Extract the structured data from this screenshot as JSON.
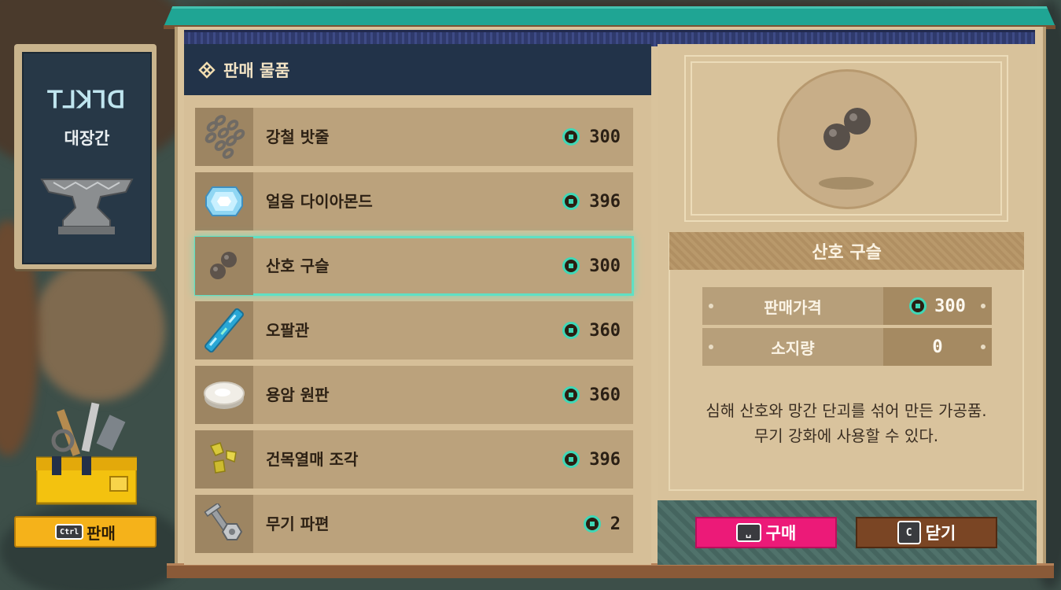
{
  "shop": {
    "sign_glyph": "ꓔ⅃ꓘꓶꓷ",
    "sign_label": "대장간",
    "sell_key": "Ctrl",
    "sell_label": "판매"
  },
  "list": {
    "header_title": "판매 물품",
    "items": [
      {
        "name": "강철 밧줄",
        "price": "300",
        "icon": "chain-icon"
      },
      {
        "name": "얼음 다이아몬드",
        "price": "396",
        "icon": "ice-diamond-icon"
      },
      {
        "name": "산호 구슬",
        "price": "300",
        "icon": "coral-beads-icon"
      },
      {
        "name": "오팔관",
        "price": "360",
        "icon": "opal-tube-icon"
      },
      {
        "name": "용암 원판",
        "price": "360",
        "icon": "lava-disc-icon"
      },
      {
        "name": "건목열매 조각",
        "price": "396",
        "icon": "dry-fruit-shard-icon"
      },
      {
        "name": "무기 파편",
        "price": "2",
        "icon": "bolt-nut-icon"
      }
    ],
    "selected_index": 2
  },
  "detail": {
    "title": "산호 구슬",
    "sell_price_label": "판매가격",
    "sell_price_value": "300",
    "owned_label": "소지량",
    "owned_value": "0",
    "description_line1": "심해 산호와 망간 단괴를 섞어 만든 가공품.",
    "description_line2": "무기 강화에 사용할 수 있다."
  },
  "buttons": {
    "buy_key": "␣",
    "buy_label": "구매",
    "close_key": "C",
    "close_label": "닫기"
  },
  "colors": {
    "accent_teal": "#1fa594",
    "coin": "#3fd7b6",
    "buy": "#ec1a78",
    "close": "#7a4524",
    "navy": "#223349"
  }
}
